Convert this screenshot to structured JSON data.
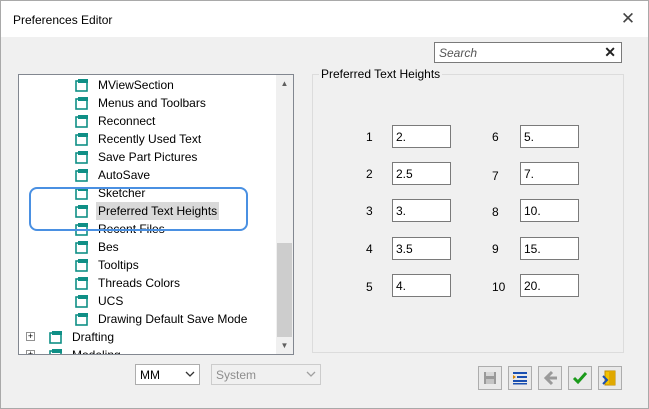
{
  "window": {
    "title": "Preferences Editor"
  },
  "search": {
    "placeholder": "Search",
    "value": ""
  },
  "tree": {
    "items": [
      {
        "label": "MViewSection"
      },
      {
        "label": "Menus and Toolbars"
      },
      {
        "label": "Reconnect"
      },
      {
        "label": "Recently Used Text"
      },
      {
        "label": "Save Part Pictures"
      },
      {
        "label": "AutoSave"
      },
      {
        "label": "Sketcher"
      },
      {
        "label": "Preferred Text Heights",
        "selected": true
      },
      {
        "label": "Recent Files"
      },
      {
        "label": "Bes"
      },
      {
        "label": "Tooltips"
      },
      {
        "label": "Threads Colors"
      },
      {
        "label": "UCS"
      },
      {
        "label": "Drawing Default Save Mode"
      },
      {
        "label": "Drafting",
        "expander": "+"
      },
      {
        "label": "Modeling",
        "expander": "+"
      }
    ]
  },
  "panel": {
    "title": "Preferred Text Heights",
    "left_column": [
      {
        "num": "1",
        "value": "2."
      },
      {
        "num": "2",
        "value": "2.5"
      },
      {
        "num": "3",
        "value": "3."
      },
      {
        "num": "4",
        "value": "3.5"
      },
      {
        "num": "5",
        "value": "4."
      }
    ],
    "right_column": [
      {
        "num": "6",
        "value": "5."
      },
      {
        "num": "7",
        "value": "7."
      },
      {
        "num": "8",
        "value": "10."
      },
      {
        "num": "9",
        "value": "15."
      },
      {
        "num": "10",
        "value": "20."
      }
    ]
  },
  "bottom": {
    "units": "MM",
    "scope": "System",
    "buttons": [
      "save-icon",
      "import-list-icon",
      "revert-icon",
      "apply-checkmark-icon",
      "exit-icon"
    ]
  },
  "colors": {
    "highlight": "#4a90e2",
    "tree_icon": "#0f8f86",
    "checkmark": "#1a9a1a"
  }
}
